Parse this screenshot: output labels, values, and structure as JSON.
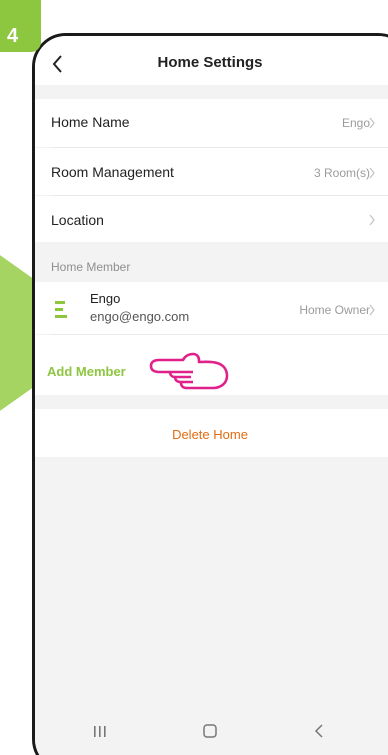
{
  "step_badge": "4",
  "header": {
    "title": "Home Settings"
  },
  "settings": {
    "home_name": {
      "label": "Home Name",
      "value": "Engo"
    },
    "room_management": {
      "label": "Room Management",
      "value": "3 Room(s)"
    },
    "location": {
      "label": "Location",
      "value": ""
    }
  },
  "members_section": {
    "title": "Home Member",
    "members": [
      {
        "name": "Engo",
        "email": "engo@engo.com",
        "role": "Home Owner"
      }
    ],
    "add_label": "Add Member"
  },
  "delete_label": "Delete Home",
  "colors": {
    "accent_green": "#8dc63f",
    "arrow_green": "#a6d463",
    "delete_orange": "#e36b10",
    "pointer_pink": "#e0218a",
    "background": "#f3f3f4"
  },
  "icons": {
    "back": "chevron-left-icon",
    "row_chevron": "chevron-right-icon",
    "avatar": "engo-logo-icon",
    "pointer": "pointing-hand-icon",
    "recents": "recent-apps-icon",
    "home": "home-icon",
    "back_nav": "back-nav-icon"
  }
}
